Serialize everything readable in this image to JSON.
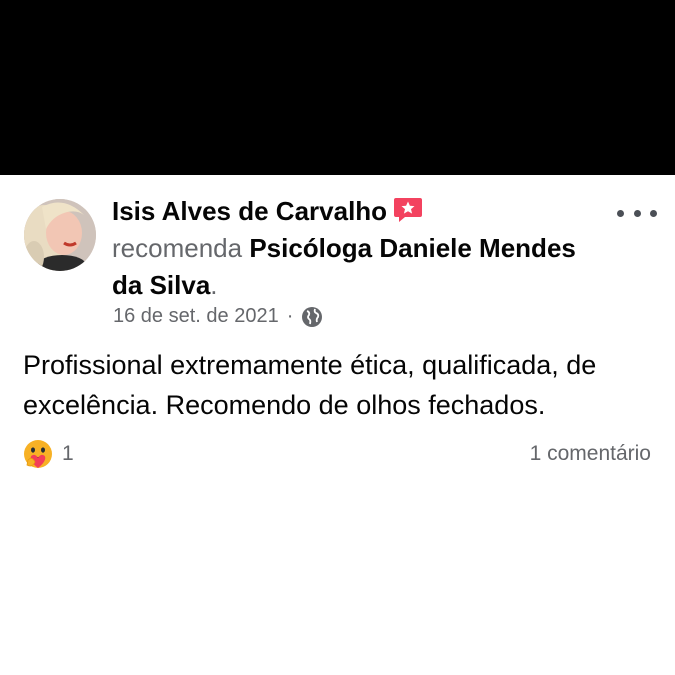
{
  "post": {
    "author": "Isis Alves de Carvalho",
    "verb": "recomenda",
    "page_name": "Psicóloga Daniele Mendes da Silva",
    "period": ".",
    "date": "16 de set. de 2021",
    "separator": "·",
    "privacy_icon": "globe-icon",
    "badge_icon": "recommendation-star-icon",
    "badge_color": "#f3425f",
    "text": "Profissional extremamente ética, qualificada, de excelência. Recomendo de olhos fechados.",
    "reaction_icon": "care-reaction-icon",
    "reaction_count": "1",
    "comments": "1 comentário"
  },
  "colors": {
    "top_bar": "#000000",
    "text_primary": "#050505",
    "text_secondary": "#65676b"
  }
}
